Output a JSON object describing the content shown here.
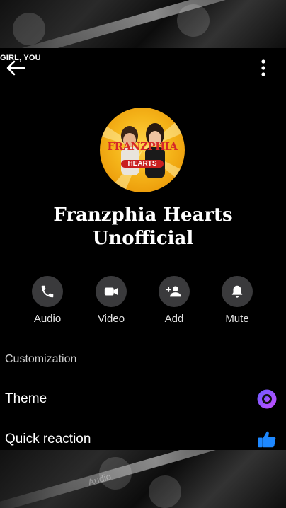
{
  "overlay": {
    "top_text": "GIRL, YOU",
    "bottom_ghost_label": "Audio"
  },
  "group": {
    "name_line1": "Franzphia Hearts",
    "name_line2": "Unofficial",
    "avatar_text_line1": "FRANZPHIA",
    "avatar_text_line2": "HEARTS"
  },
  "actions": [
    {
      "label": "Audio",
      "icon": "phone-icon"
    },
    {
      "label": "Video",
      "icon": "video-camera-icon"
    },
    {
      "label": "Add",
      "icon": "add-person-icon"
    },
    {
      "label": "Mute",
      "icon": "bell-icon"
    }
  ],
  "customization": {
    "section_title": "Customization",
    "theme_label": "Theme",
    "quick_reaction_label": "Quick reaction"
  },
  "colors": {
    "background": "#000000",
    "action_circle": "#3a3a3c",
    "theme_gradient_start": "#6a5cff",
    "theme_gradient_end": "#c84dff",
    "thumb_blue": "#1e88ff"
  }
}
